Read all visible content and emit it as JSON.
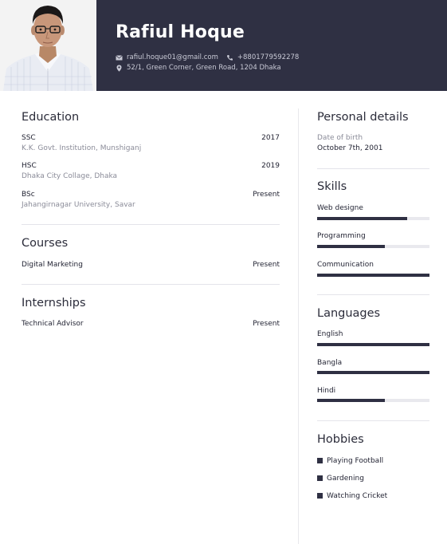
{
  "header": {
    "name": "Rafiul Hoque",
    "email": "rafiul.hoque01@gmail.com",
    "phone": "+8801779592278",
    "address": "52/1, Green Corner, Green Road, 1204 Dhaka",
    "photo_icon": "profile-photo"
  },
  "education": {
    "title": "Education",
    "items": [
      {
        "degree": "SSC",
        "institution": "K.K. Govt. Institution, Munshiganj",
        "date": "2017"
      },
      {
        "degree": "HSC",
        "institution": "Dhaka City Collage, Dhaka",
        "date": "2019"
      },
      {
        "degree": "BSc",
        "institution": "Jahangirnagar University, Savar",
        "date": "Present"
      }
    ]
  },
  "courses": {
    "title": "Courses",
    "items": [
      {
        "name": "Digital Marketing",
        "date": "Present"
      }
    ]
  },
  "internships": {
    "title": "Internships",
    "items": [
      {
        "name": "Technical Advisor",
        "date": "Present"
      }
    ]
  },
  "personal": {
    "title": "Personal details",
    "dob_label": "Date of birth",
    "dob_value": "October 7th, 2001"
  },
  "skills": {
    "title": "Skills",
    "items": [
      {
        "name": "Web designe",
        "level": 0.8
      },
      {
        "name": "Programming",
        "level": 0.6
      },
      {
        "name": "Communication",
        "level": 1.0
      }
    ]
  },
  "languages": {
    "title": "Languages",
    "items": [
      {
        "name": "English",
        "level": 1.0
      },
      {
        "name": "Bangla",
        "level": 1.0
      },
      {
        "name": "Hindi",
        "level": 0.6
      }
    ]
  },
  "hobbies": {
    "title": "Hobbies",
    "items": [
      "Playing Football",
      "Gardening",
      "Watching Cricket"
    ]
  },
  "colors": {
    "header_bg": "#2f3043",
    "bar_fill": "#2f3043",
    "bar_track": "#e9e9ee"
  }
}
